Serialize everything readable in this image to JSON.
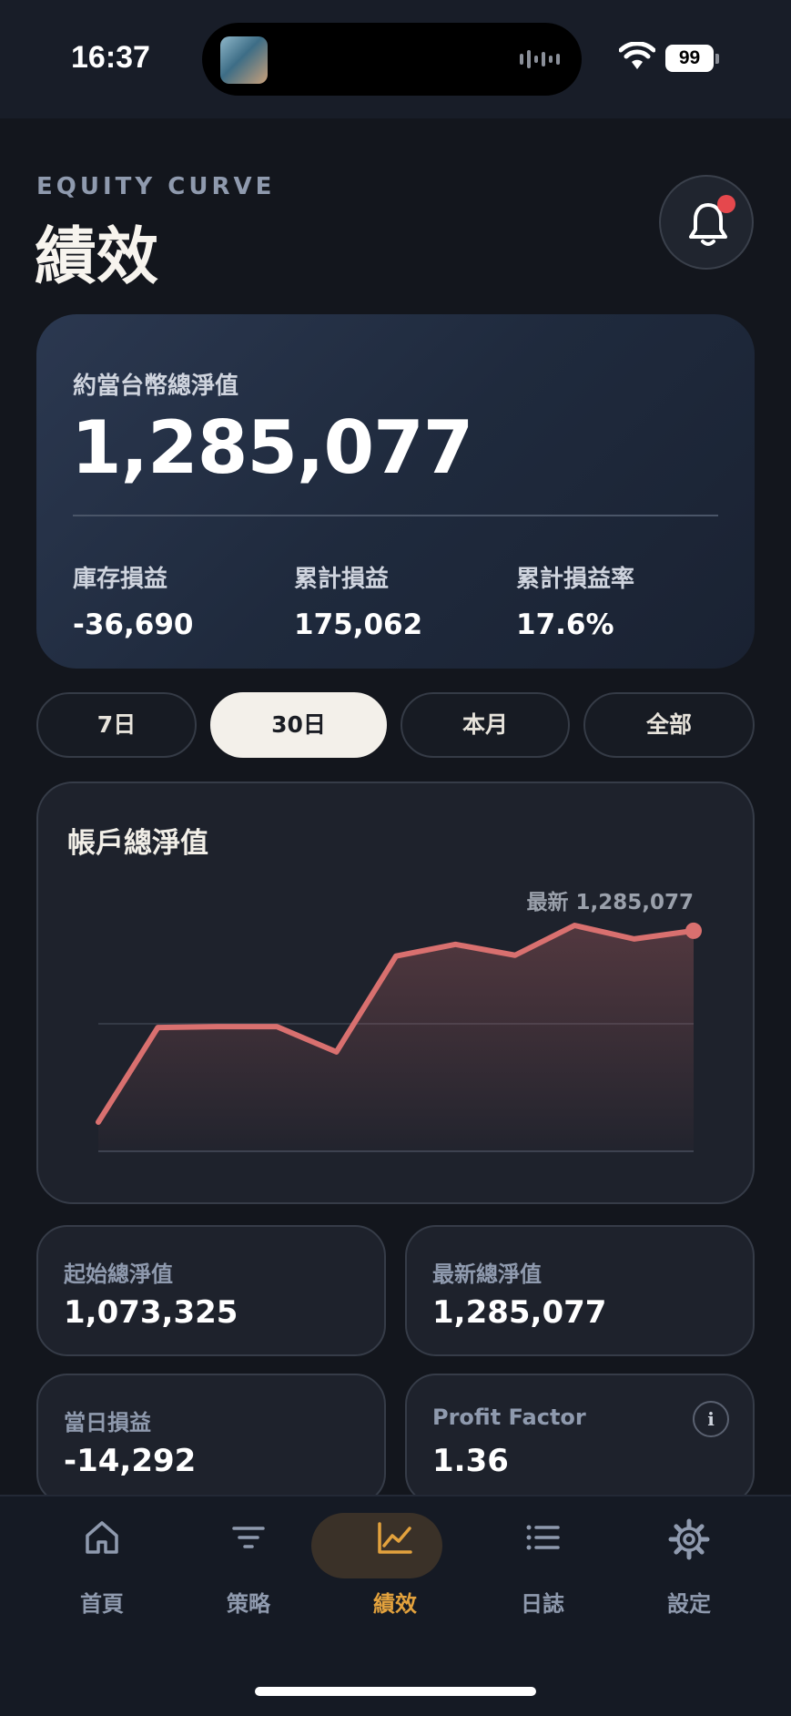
{
  "status_bar": {
    "time": "16:37",
    "battery": "99"
  },
  "header": {
    "eyebrow": "EQUITY CURVE",
    "title": "績效"
  },
  "summary": {
    "label": "約當台幣總淨值",
    "value": "1,285,077",
    "stats": [
      {
        "label": "庫存損益",
        "value": "-36,690"
      },
      {
        "label": "累計損益",
        "value": "175,062"
      },
      {
        "label": "累計損益率",
        "value": "17.6%"
      }
    ]
  },
  "range_tabs": [
    {
      "label": "7日",
      "active": false
    },
    {
      "label": "30日",
      "active": true
    },
    {
      "label": "本月",
      "active": false
    },
    {
      "label": "全部",
      "active": false
    }
  ],
  "chart_panel": {
    "title": "帳戶總淨值",
    "latest_label": "最新 1,285,077"
  },
  "chart_data": {
    "type": "area",
    "title": "帳戶總淨值",
    "series": [
      {
        "values": [
          1073325,
          1178000,
          1179000,
          1179000,
          1151000,
          1257000,
          1270000,
          1258000,
          1291000,
          1276000,
          1285077
        ]
      }
    ],
    "line_color": "#d9706f",
    "grid": true
  },
  "stat_cards": [
    {
      "label": "起始總淨值",
      "value": "1,073,325"
    },
    {
      "label": "最新總淨值",
      "value": "1,285,077"
    },
    {
      "label": "當日損益",
      "value": "-14,292"
    },
    {
      "label": "Profit Factor",
      "value": "1.36",
      "icon": "info-icon"
    }
  ],
  "tab_bar": [
    {
      "label": "首頁",
      "icon": "home-icon",
      "active": false
    },
    {
      "label": "策略",
      "icon": "filter-icon",
      "active": false
    },
    {
      "label": "績效",
      "icon": "chart-line-icon",
      "active": true
    },
    {
      "label": "日誌",
      "icon": "list-icon",
      "active": false
    },
    {
      "label": "設定",
      "icon": "gear-icon",
      "active": false
    }
  ],
  "colors": {
    "accent": "#e3a23d",
    "alert_dot": "#e5484d",
    "chart_line": "#d9706f"
  }
}
